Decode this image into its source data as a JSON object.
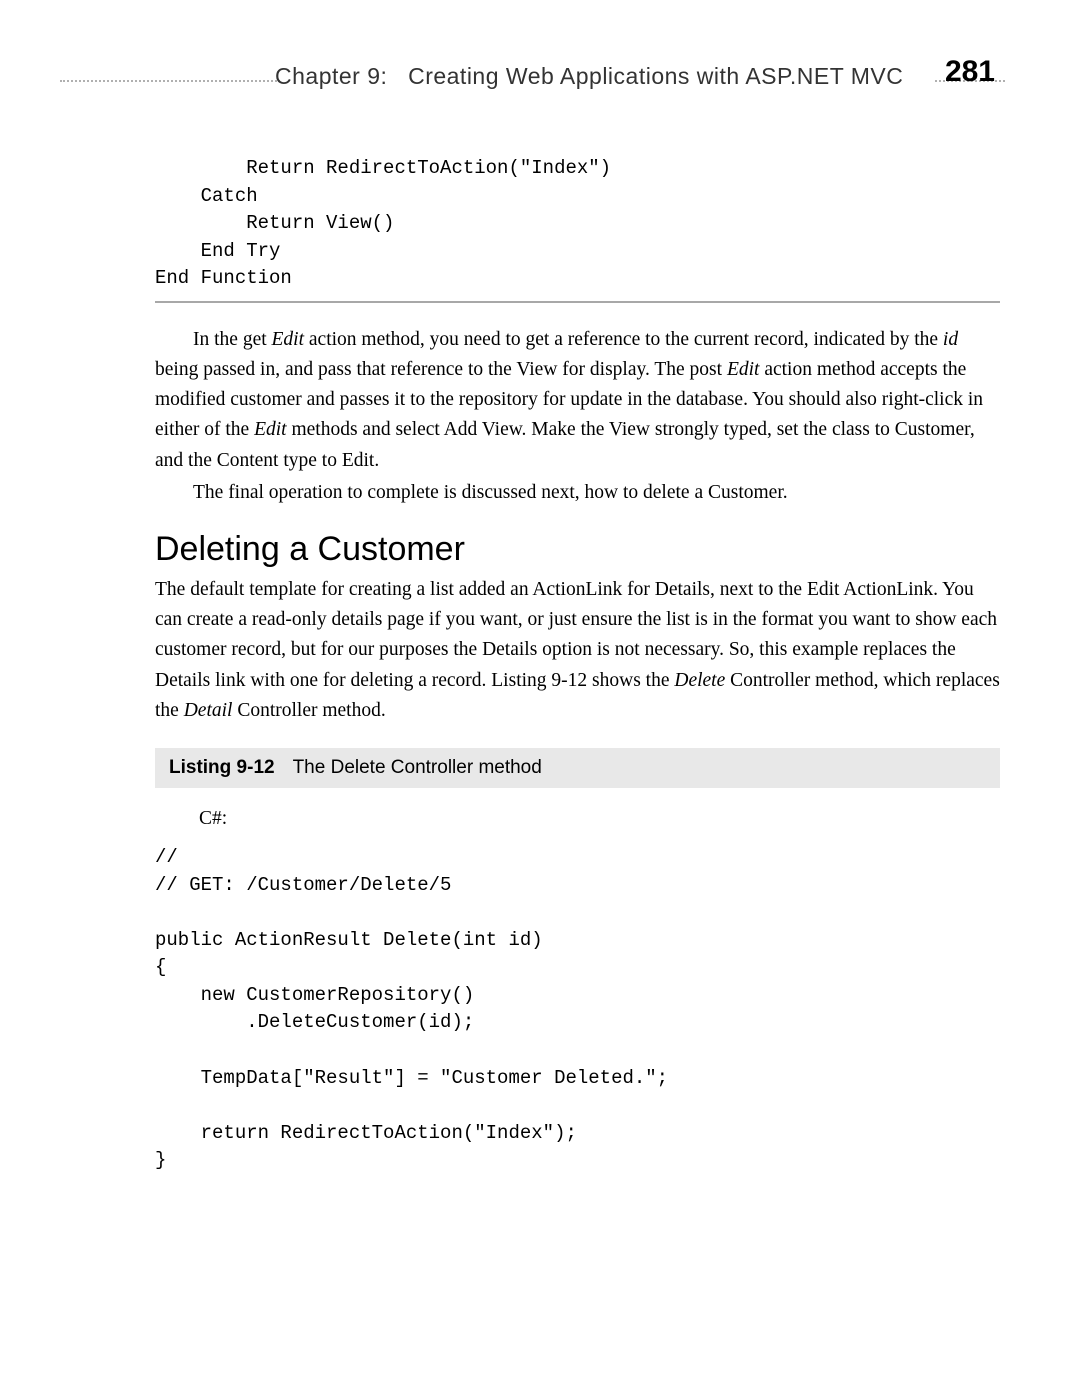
{
  "header": {
    "chapter_label": "Chapter 9:",
    "chapter_title": "Creating Web Applications with ASP.NET MVC",
    "page_number": "281"
  },
  "code_top": "        Return RedirectToAction(\"Index\")\n    Catch\n        Return View()\n    End Try\nEnd Function",
  "para1_parts": {
    "a": "In the get ",
    "b": "Edit",
    "c": " action method, you need to get a reference to the current record, indicated by the ",
    "d": "id",
    "e": " being passed in, and pass that reference to the View for display. The post ",
    "f": "Edit",
    "g": " action method accepts the modified customer and passes it to the repository for update in the database. You should also right-click in either of the ",
    "h": "Edit",
    "i": " methods and select Add View. Make the View strongly typed, set the class to Customer, and the Content type to Edit."
  },
  "para2": "The final operation to complete is discussed next, how to delete a Customer.",
  "section_heading": "Deleting a Customer",
  "para3_parts": {
    "a": "The default template for creating a list added an ActionLink for Details, next to the Edit ActionLink. You can create a read-only details page if you want, or just ensure the list is in the format you want to show each customer record, but for our purposes the Details option is not necessary. So, this example replaces the Details link with one for deleting a record. Listing 9-12 shows the ",
    "b": "Delete",
    "c": " Controller method, which replaces the ",
    "d": "Detail",
    "e": " Controller method."
  },
  "listing": {
    "number": "Listing 9-12",
    "title": "The Delete Controller method"
  },
  "lang_label": "C#:",
  "code_main": "//\n// GET: /Customer/Delete/5\n\npublic ActionResult Delete(int id)\n{\n    new CustomerRepository()\n        .DeleteCustomer(id);\n\n    TempData[\"Result\"] = \"Customer Deleted.\";\n\n    return RedirectToAction(\"Index\");\n}"
}
